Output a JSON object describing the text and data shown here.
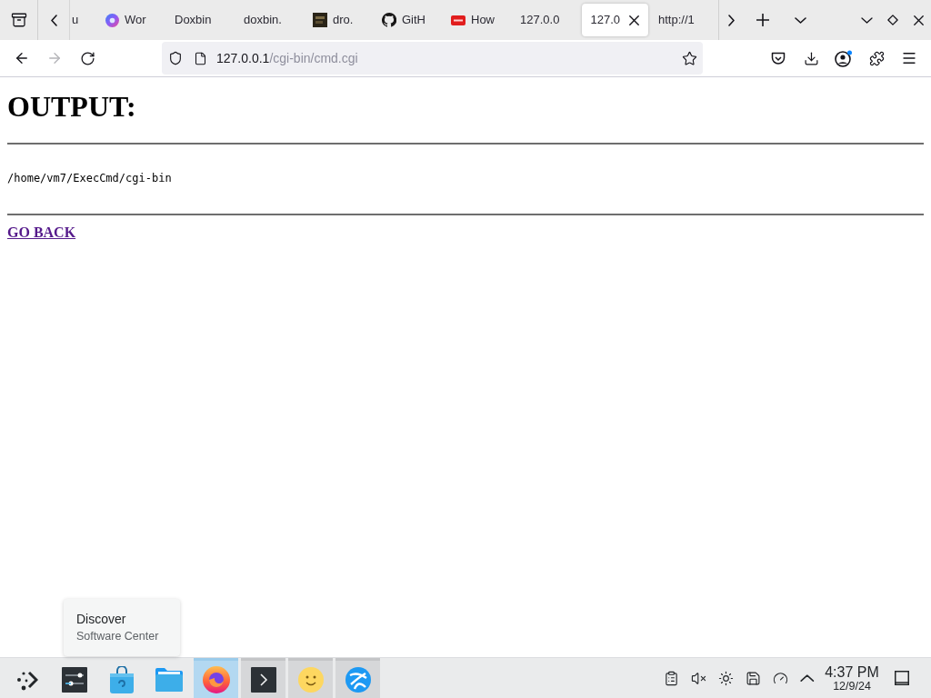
{
  "tab_bar": {
    "tabs": [
      {
        "label": "u",
        "kind": "plain",
        "selected": false
      },
      {
        "label": "Wor",
        "kind": "swirl",
        "selected": false
      },
      {
        "label": "Doxbin",
        "kind": "plain",
        "selected": false
      },
      {
        "label": "doxbin.",
        "kind": "plain",
        "selected": false
      },
      {
        "label": "dro.",
        "kind": "thumbnail",
        "selected": false
      },
      {
        "label": "GitH",
        "kind": "octocat",
        "selected": false
      },
      {
        "label": "How",
        "kind": "video-badge",
        "selected": false
      },
      {
        "label": "127.0.0",
        "kind": "plain",
        "selected": false
      },
      {
        "label": "127.0",
        "kind": "plain",
        "selected": true
      },
      {
        "label": "http://1",
        "kind": "plain",
        "selected": false
      }
    ]
  },
  "nav_bar": {
    "buttons": [
      {
        "kind": "back",
        "disabled": false
      },
      {
        "kind": "forward",
        "disabled": true
      },
      {
        "kind": "reload",
        "disabled": false
      }
    ],
    "address": {
      "host": "127.0.0.1",
      "path": "/cgi-bin/cmd.cgi"
    }
  },
  "page": {
    "heading": "OUTPUT:",
    "output": "/home/vm7/ExecCmd/cgi-bin",
    "link": {
      "label": "GO BACK",
      "visited": true
    }
  },
  "tooltip": {
    "title": "Discover",
    "subtitle": "Software Center"
  },
  "taskbar": {
    "tasks": [
      {
        "kind": "launcher",
        "running": false,
        "selected": false
      },
      {
        "kind": "settings",
        "running": false,
        "selected": false
      },
      {
        "kind": "store",
        "running": false,
        "selected": false
      },
      {
        "kind": "files",
        "running": false,
        "selected": false
      },
      {
        "kind": "browser",
        "running": true,
        "selected": true
      },
      {
        "kind": "terminal",
        "running": true,
        "selected": false
      },
      {
        "kind": "smiley",
        "running": true,
        "selected": false
      },
      {
        "kind": "globe",
        "running": true,
        "selected": false
      }
    ],
    "tray": [
      {
        "kind": "clipboard"
      },
      {
        "kind": "muted"
      },
      {
        "kind": "brightness"
      },
      {
        "kind": "disk"
      },
      {
        "kind": "gauge"
      },
      {
        "kind": "expand"
      }
    ],
    "clock": {
      "time": "4:37 PM",
      "date": "12/9/24"
    }
  }
}
